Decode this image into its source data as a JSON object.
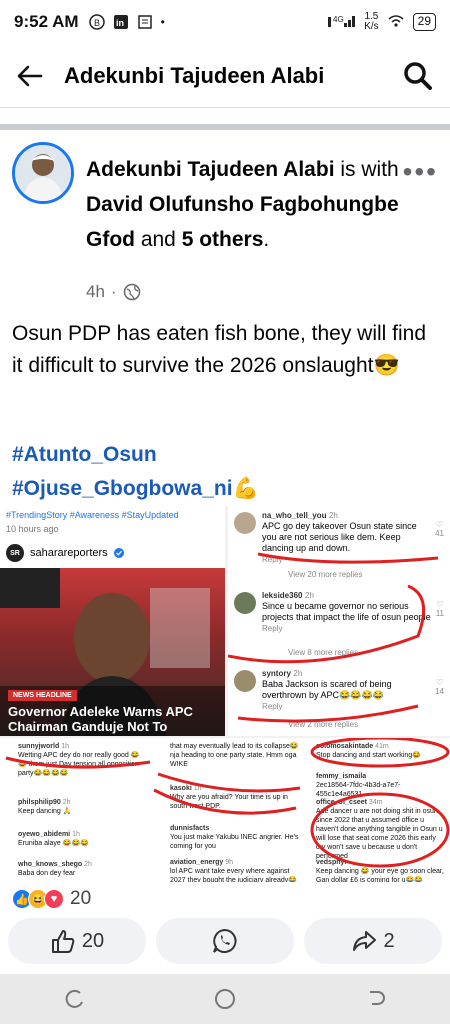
{
  "status_bar": {
    "time": "9:52 AM",
    "icons": [
      "b-circle-icon",
      "linkedin-icon",
      "notes-icon",
      "dot-icon"
    ],
    "signal": "4G",
    "speed_value": "1.5",
    "speed_unit": "K/s",
    "battery": "29"
  },
  "header": {
    "title": "Adekunbi Tajudeen Alabi"
  },
  "post": {
    "author": "Adekunbi Tajudeen Alabi",
    "with_text": "is with",
    "tagged": "David Olufunsho Fagbohungbe Gfod",
    "and_text": "and",
    "others": "5 others",
    "time": "4h",
    "text": "Osun PDP has eaten fish bone, they will find it difficult to survive the 2026 onslaught😎",
    "hashtags": [
      "#Atunto_Osun",
      "#Ojuse_Gbogbowa_ni💪"
    ]
  },
  "media": {
    "left": {
      "tags": "#TrendingStory #Awareness #StayUpdated",
      "ago": "10 hours ago",
      "source": "saharareporters",
      "badge": "SR",
      "photo_tag": "NEWS HEADLINE",
      "headline": "Governor Adeleke Warns APC Chairman Ganduje Not To"
    },
    "right_comments": [
      {
        "user": "na_who_tell_you",
        "time": "2h",
        "text": "APC go dey takeover Osun state since you are not serious like dem. Keep dancing up and down.",
        "reply": "Reply",
        "likes": "41"
      },
      {
        "user": "lekside360",
        "time": "2h",
        "text": "Since u became governor no serious projects that impact the life of osun people",
        "reply": "Reply",
        "likes": "11"
      },
      {
        "user": "syntory",
        "time": "2h",
        "text": "Baba Jackson is scared of being overthrown by APC😂😂😂😂",
        "reply": "Reply",
        "likes": "14"
      }
    ],
    "view_replies": [
      "View 20 more replies",
      "View 8 more replies",
      "View 2 more replies"
    ],
    "bottom_col1": [
      {
        "user": "sunnyjworld",
        "time": "1h",
        "text": "Wetting APC dey do nor really good 😂😂 them just Day tension all opposition party😂😂😂😂"
      },
      {
        "user": "philsphilip90",
        "time": "2h",
        "text": "Keep dancing 🙏"
      },
      {
        "user": "oyewo_abidemi",
        "time": "1h",
        "text": "Eruniba alaye 😂😂😂"
      },
      {
        "user": "who_knows_shego",
        "time": "2h",
        "text": "Baba don dey fear"
      }
    ],
    "bottom_col2": [
      {
        "user": "",
        "time": "",
        "text": "that may eventually lead to its collapse😂 nja heading to one party state. Hmm oga WIKE"
      },
      {
        "user": "kasoki",
        "time": "1h",
        "text": "Why are you afraid? Your time is up in south west PDP."
      },
      {
        "user": "dunnisfacts",
        "time": "",
        "text": "You just make Yakubu INEC angrier. He's coming for you"
      },
      {
        "user": "aviation_energy",
        "time": "9h",
        "text": "lol APC want take every where against 2027 they bought the judiciary already😂"
      }
    ],
    "bottom_col3": [
      {
        "user": "solomosakintade",
        "time": "41m",
        "text": "Stop dancing and start working😂"
      },
      {
        "user": "femmy_ismaila",
        "time": "",
        "text": "2ec18564-7fdc-4b3d-a7e7-455c1e4a6531"
      },
      {
        "user": "office_of_cseet",
        "time": "34m",
        "text": "Ade dancer u are not doing shit in osun since 2022 that u assumed office u haven't done anything tangible in Osun u will lose that seat come 2026 this early cry won't save u because u don't performed"
      },
      {
        "user": "vedsphyr",
        "time": "",
        "text": "Keep dancing 😂 your eye go soon clear, Gan dollar £6 is coming for u😂😂"
      }
    ]
  },
  "reactions": {
    "count": "20"
  },
  "actions": {
    "like_count": "20",
    "share_count": "2"
  },
  "colors": {
    "accent": "#1877f2",
    "hashtag": "#1a5ab8",
    "muted": "#65676b",
    "annotation_red": "#e02020"
  }
}
